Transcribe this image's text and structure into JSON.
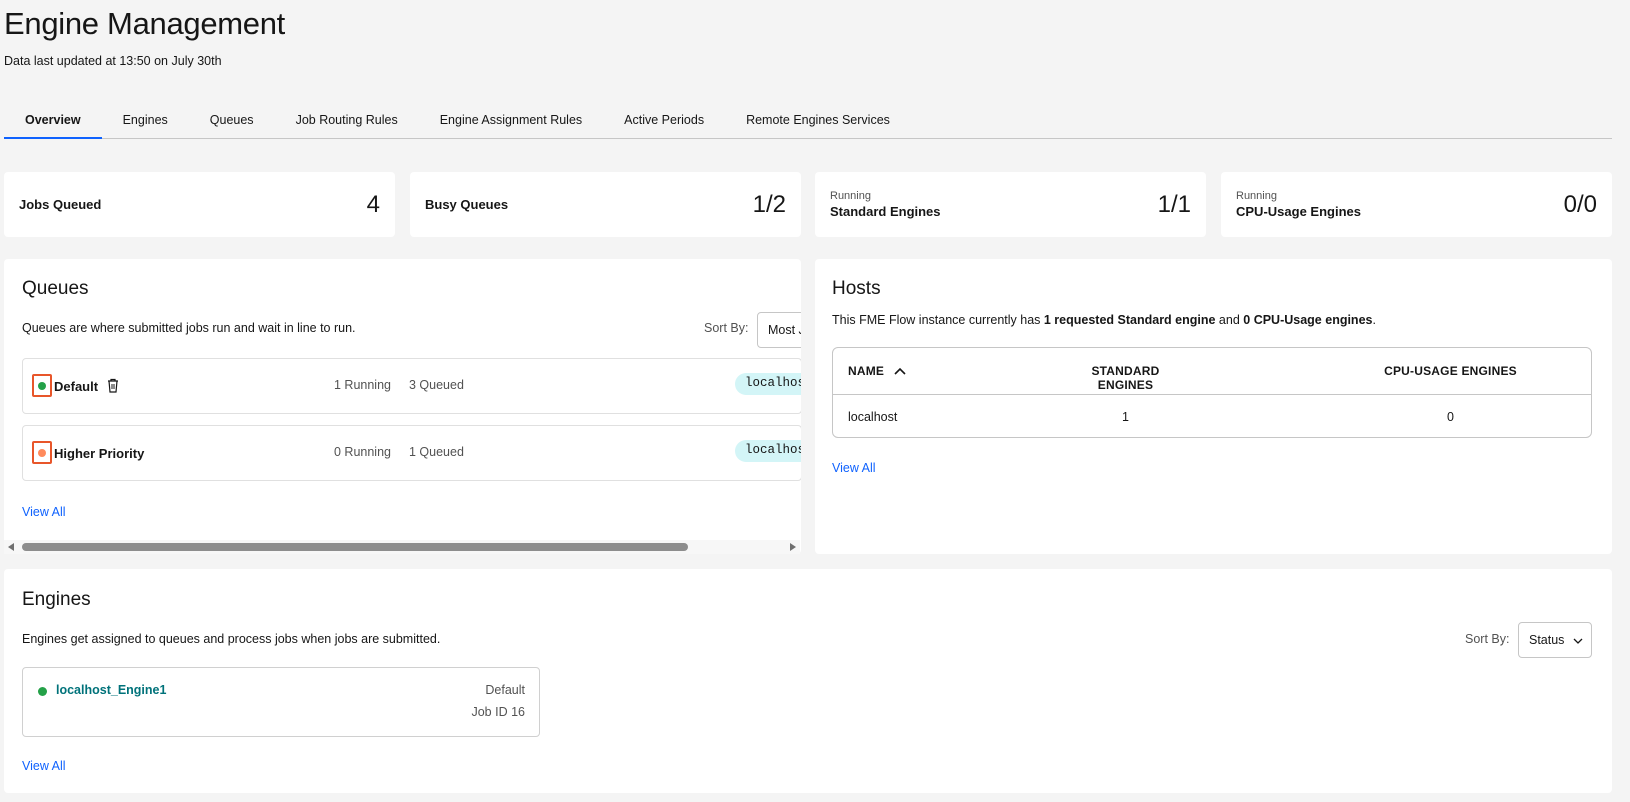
{
  "page": {
    "title": "Engine Management",
    "subtitle": "Data last updated at 13:50 on July 30th"
  },
  "tabs": [
    "Overview",
    "Engines",
    "Queues",
    "Job Routing Rules",
    "Engine Assignment Rules",
    "Active Periods",
    "Remote Engines Services"
  ],
  "stats": {
    "jobs_queued": {
      "label": "Jobs Queued",
      "value": "4"
    },
    "busy_queues": {
      "label": "Busy Queues",
      "value": "1/2"
    },
    "standard_engines": {
      "pre": "Running",
      "label": "Standard Engines",
      "value": "1/1"
    },
    "cpu_engines": {
      "pre": "Running",
      "label": "CPU-Usage Engines",
      "value": "0/0"
    }
  },
  "queues": {
    "title": "Queues",
    "description": "Queues are where submitted jobs run and wait in line to run.",
    "sort_label": "Sort By:",
    "sort_value": "Most Jobs",
    "rows": [
      {
        "name": "Default",
        "running": "1 Running",
        "queued": "3 Queued",
        "host": "localhost",
        "status_color": "#24a148"
      },
      {
        "name": "Higher Priority",
        "running": "0 Running",
        "queued": "1 Queued",
        "host": "localhost",
        "status_color": "#ff8a5c"
      }
    ],
    "view_all": "View All"
  },
  "hosts": {
    "title": "Hosts",
    "desc_pre": "This FME Flow instance currently has ",
    "desc_bold1": "1 requested Standard engine",
    "desc_mid": " and ",
    "desc_bold2": "0 CPU-Usage engines",
    "desc_end": ".",
    "columns": [
      "NAME",
      "STANDARD ENGINES",
      "CPU-USAGE ENGINES"
    ],
    "rows": [
      {
        "name": "localhost",
        "standard": "1",
        "cpu": "0"
      }
    ],
    "view_all": "View All"
  },
  "engines": {
    "title": "Engines",
    "description": "Engines get assigned to queues and process jobs when jobs are submitted.",
    "sort_label": "Sort By:",
    "sort_value": "Status",
    "items": [
      {
        "name": "localhost_Engine1",
        "queue": "Default",
        "job": "Job ID 16",
        "status_color": "#24a148"
      }
    ],
    "view_all": "View All"
  },
  "colors": {
    "accent": "#0f62fe",
    "running": "#24a148",
    "warning_border": "#e8562a",
    "chip": "#d3f5f7",
    "engine_link": "#00727a"
  }
}
